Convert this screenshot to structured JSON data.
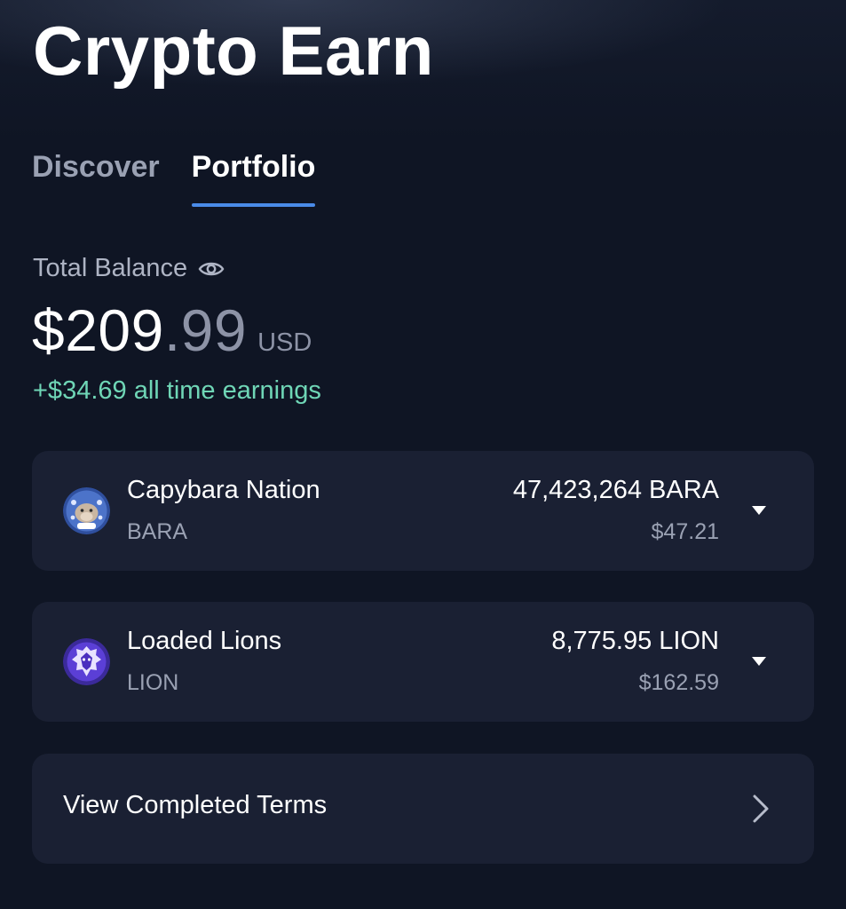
{
  "header": {
    "title": "Crypto Earn"
  },
  "tabs": [
    {
      "label": "Discover",
      "active": false
    },
    {
      "label": "Portfolio",
      "active": true
    }
  ],
  "balance": {
    "label": "Total Balance",
    "integer_part": "$209",
    "decimal_part": ".99",
    "currency": "USD",
    "earnings": "+$34.69 all time earnings"
  },
  "assets": [
    {
      "name": "Capybara Nation",
      "symbol": "BARA",
      "amount": "47,423,264 BARA",
      "usd_value": "$47.21",
      "icon": "capybara-logo-icon"
    },
    {
      "name": "Loaded Lions",
      "symbol": "LION",
      "amount": "8,775.95 LION",
      "usd_value": "$162.59",
      "icon": "lion-logo-icon"
    }
  ],
  "completed_terms": {
    "label": "View Completed Terms"
  },
  "colors": {
    "background": "#0f1524",
    "card": "#1a2033",
    "accent": "#4a8be8",
    "earnings_green": "#6fd6b6",
    "muted_text": "#9aa1b3"
  }
}
